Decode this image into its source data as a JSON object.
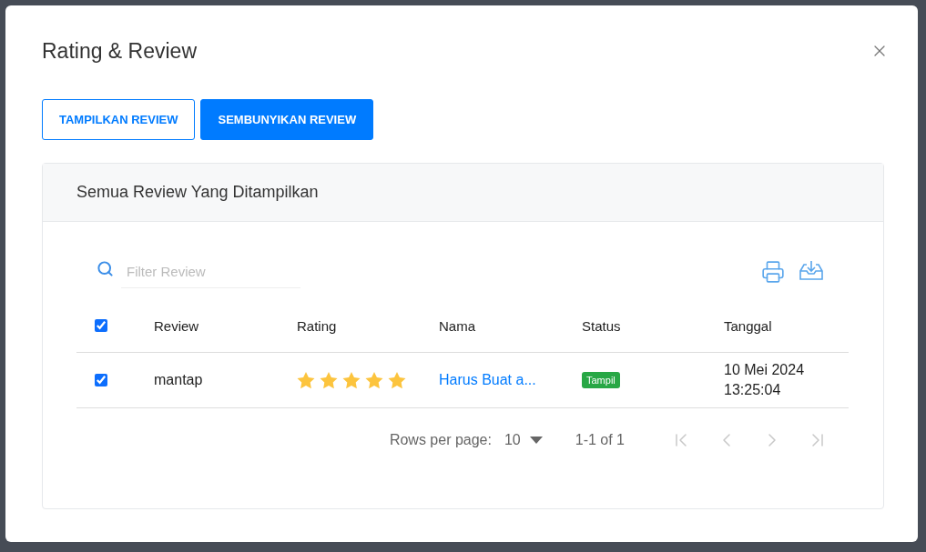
{
  "dialog": {
    "title": "Rating & Review",
    "closable": true
  },
  "buttons": [
    {
      "label": "TAMPILKAN REVIEW",
      "kind": "outline"
    },
    {
      "label": "SEMBUNYIKAN REVIEW",
      "kind": "solid"
    }
  ],
  "card": {
    "title": "Semua Review Yang Ditampilkan"
  },
  "search": {
    "placeholder": "Filter Review"
  },
  "table": {
    "all_checked": true,
    "columns": [
      "Review",
      "Rating",
      "Nama",
      "Status",
      "Tanggal"
    ],
    "rows": [
      {
        "checked": true,
        "review": "mantap",
        "stars": 5,
        "nama": "Harus Buat a...",
        "status": {
          "label": "Tampil",
          "color": "#28a745"
        },
        "tanggal": "10 Mei 2024 13:25:04"
      }
    ]
  },
  "pagination": {
    "rows_label": "Rows per page:",
    "rows_value": "10",
    "range": "1-1 of 1",
    "first_disabled": true,
    "prev_disabled": true,
    "next_disabled": true,
    "last_disabled": true
  }
}
